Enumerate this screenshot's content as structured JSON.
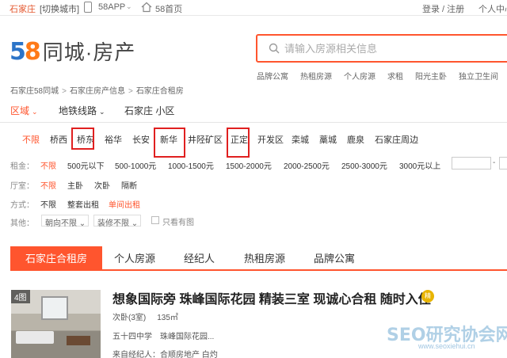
{
  "topbar": {
    "city": "石家庄",
    "switch_city": "[切换城市]",
    "app": "58APP",
    "home": "58首页",
    "login": "登录 / 注册",
    "personal_center": "个人中心"
  },
  "logo": {
    "digit5": "5",
    "digit8": "8",
    "text": "同城·房产"
  },
  "search": {
    "placeholder": "请输入房源相关信息",
    "hot_links": [
      "品牌公寓",
      "热租房源",
      "个人房源",
      "求租",
      "阳光主卧",
      "独立卫生间"
    ]
  },
  "breadcrumb": [
    "石家庄58同城",
    "石家庄房产信息",
    "石家庄合租房"
  ],
  "filter_tabs": [
    {
      "label": "区域",
      "active": true
    },
    {
      "label": "地铁线路",
      "active": false
    },
    {
      "label": "石家庄 小区",
      "active": false
    }
  ],
  "districts": [
    "不限",
    "桥西",
    "桥东",
    "裕华",
    "长安",
    "新华",
    "井陉矿区",
    "正定",
    "开发区",
    "栾城",
    "藁城",
    "鹿泉",
    "石家庄周边"
  ],
  "rent": {
    "label": "租金：",
    "options": [
      "不限",
      "500元以下",
      "500-1000元",
      "1000-1500元",
      "1500-2000元",
      "2000-2500元",
      "2500-3000元",
      "3000元以上"
    ],
    "range_sep": "-"
  },
  "room": {
    "label": "厅室：",
    "options": [
      "不限",
      "主卧",
      "次卧",
      "隔断"
    ]
  },
  "mode": {
    "label": "方式：",
    "options": [
      "不限",
      "整套出租",
      "单间出租"
    ]
  },
  "other": {
    "label": "其他：",
    "orientation": "朝向不限",
    "decoration": "装修不限",
    "has_image": "只看有图"
  },
  "list_tabs": [
    "石家庄合租房",
    "个人房源",
    "经纪人",
    "热租房源",
    "品牌公寓"
  ],
  "listing": {
    "image_count": "4图",
    "title": "想象国际旁 珠峰国际花园 精装三室 现诚心合租 随时入住",
    "badge": "精",
    "room": "次卧(3室)",
    "area": "135㎡",
    "location": "五十四中学　珠峰国际花园...",
    "source": "来自经纪人：合顺房地产 白灼"
  },
  "watermark": {
    "text": "SEO研究协会网",
    "url": "www.seoxiehui.cn"
  },
  "colors": {
    "accent": "#ff552e",
    "highlight_box": "#e02020",
    "logo_blue": "#2c74c8",
    "logo_orange": "#ff7a18"
  }
}
